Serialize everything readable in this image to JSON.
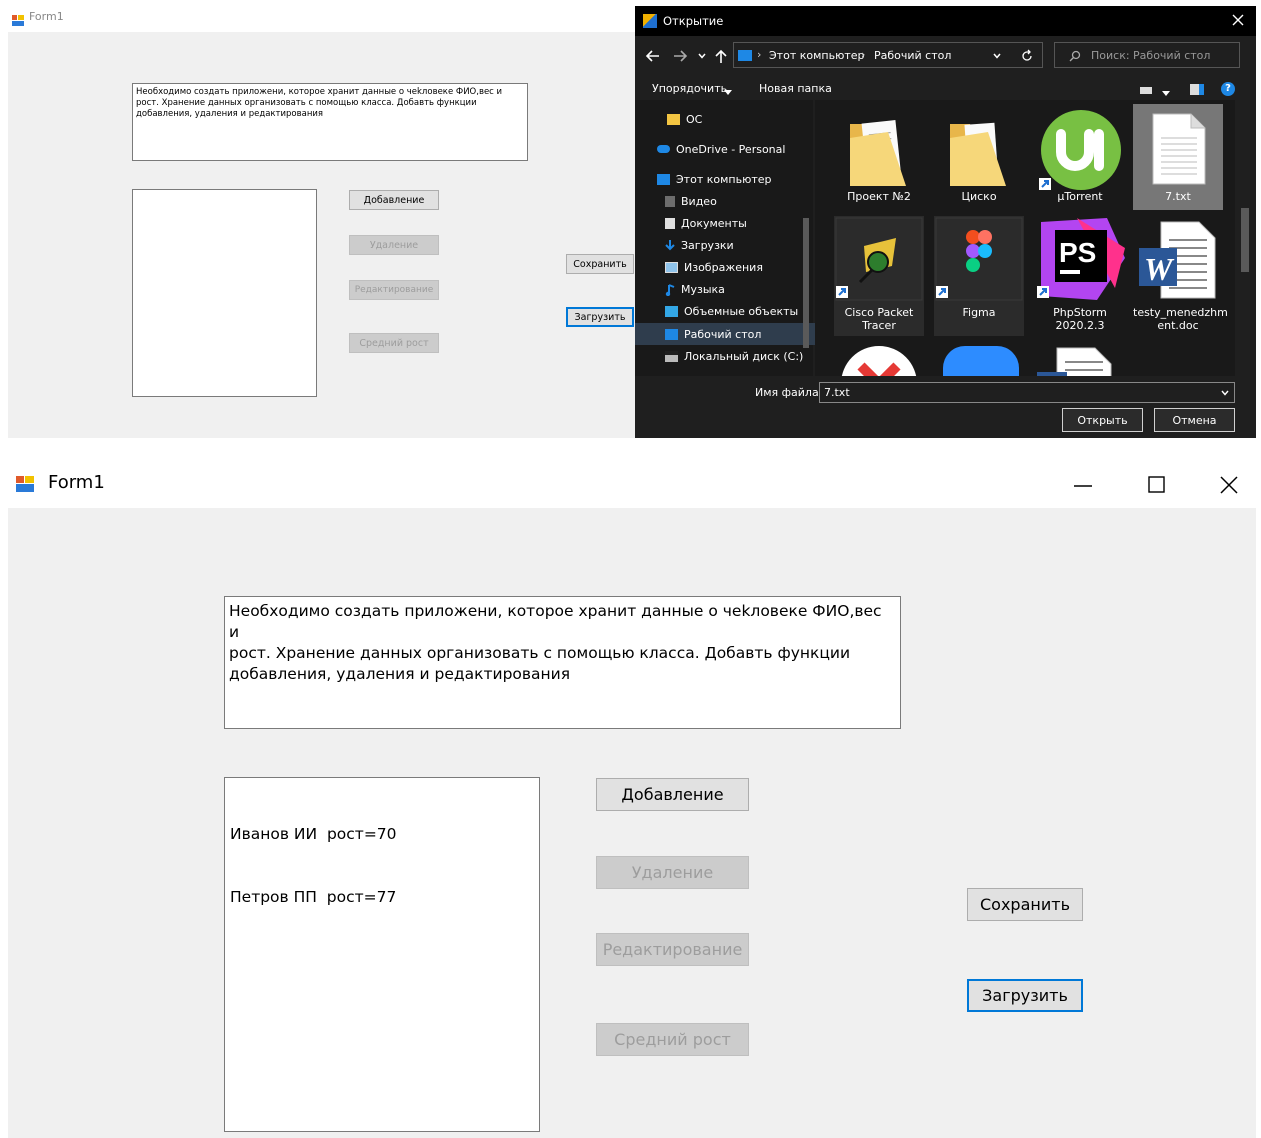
{
  "top_form": {
    "title": "Form1",
    "description": "Необходимо создать приложени, которое хранит данные о чеkловеке ФИО,вес и\nрост. Хранение данных организовать с помощью класса. Добавть функции\nдобавления, удаления и редактирования",
    "buttons": {
      "add": "Добавление",
      "delete": "Удаление",
      "edit": "Редактирование",
      "avg_height": "Средний рост",
      "save": "Сохранить",
      "load": "Загрузить"
    }
  },
  "dialog": {
    "title": "Открытие",
    "breadcrumb": [
      "Этот компьютер",
      "Рабочий стол"
    ],
    "breadcrumb_sep": "›",
    "search_placeholder": "Поиск: Рабочий стол",
    "organize": "Упорядочить",
    "new_folder": "Новая папка",
    "sidebar": [
      {
        "label": "ОС",
        "icon": "folder-icon"
      },
      {
        "label": "OneDrive - Personal",
        "icon": "cloud-icon"
      },
      {
        "label": "Этот компьютер",
        "icon": "computer-icon"
      },
      {
        "label": "Видео",
        "icon": "video-icon"
      },
      {
        "label": "Документы",
        "icon": "document-icon"
      },
      {
        "label": "Загрузки",
        "icon": "download-icon"
      },
      {
        "label": "Изображения",
        "icon": "image-icon"
      },
      {
        "label": "Музыка",
        "icon": "music-icon"
      },
      {
        "label": "Объемные объекты",
        "icon": "cube-icon"
      },
      {
        "label": "Рабочий стол",
        "icon": "desktop-icon"
      },
      {
        "label": "Локальный диск (C:)",
        "icon": "drive-icon"
      }
    ],
    "files": [
      {
        "label": "Проект №2",
        "icon": "folder-icon"
      },
      {
        "label": "Циско",
        "icon": "folder-icon"
      },
      {
        "label": "µTorrent",
        "icon": "utorrent-icon"
      },
      {
        "label": "7.txt",
        "icon": "text-file-icon"
      },
      {
        "label": "Cisco Packet\nTracer",
        "icon": "cisco-packet-tracer-icon"
      },
      {
        "label": "Figma",
        "icon": "figma-icon"
      },
      {
        "label": "PhpStorm\n2020.2.3",
        "icon": "phpstorm-icon"
      },
      {
        "label": "testy_menedzhm\nent.doc",
        "icon": "word-document-icon"
      }
    ],
    "filename_label": "Имя файла:",
    "filename_value": "7.txt",
    "open_button": "Открыть",
    "cancel_button": "Отмена"
  },
  "main_form": {
    "title": "Form1",
    "description": "Необходимо создать приложени, которое хранит данные о чеkловеке ФИО,вес и\nрост. Хранение данных организовать с помощью класса. Добавть функции\nдобавления, удаления и редактирования",
    "list_items": [
      "Иванов ИИ  рост=70",
      "Петров ПП  рост=77"
    ],
    "buttons": {
      "add": "Добавление",
      "delete": "Удаление",
      "edit": "Редактирование",
      "avg_height": "Средний рост",
      "save": "Сохранить",
      "load": "Загрузить"
    }
  },
  "colors": {
    "form_background": "#f0f0f0",
    "focus_border": "#0078d7",
    "dialog_background": "#1f1f1f"
  }
}
